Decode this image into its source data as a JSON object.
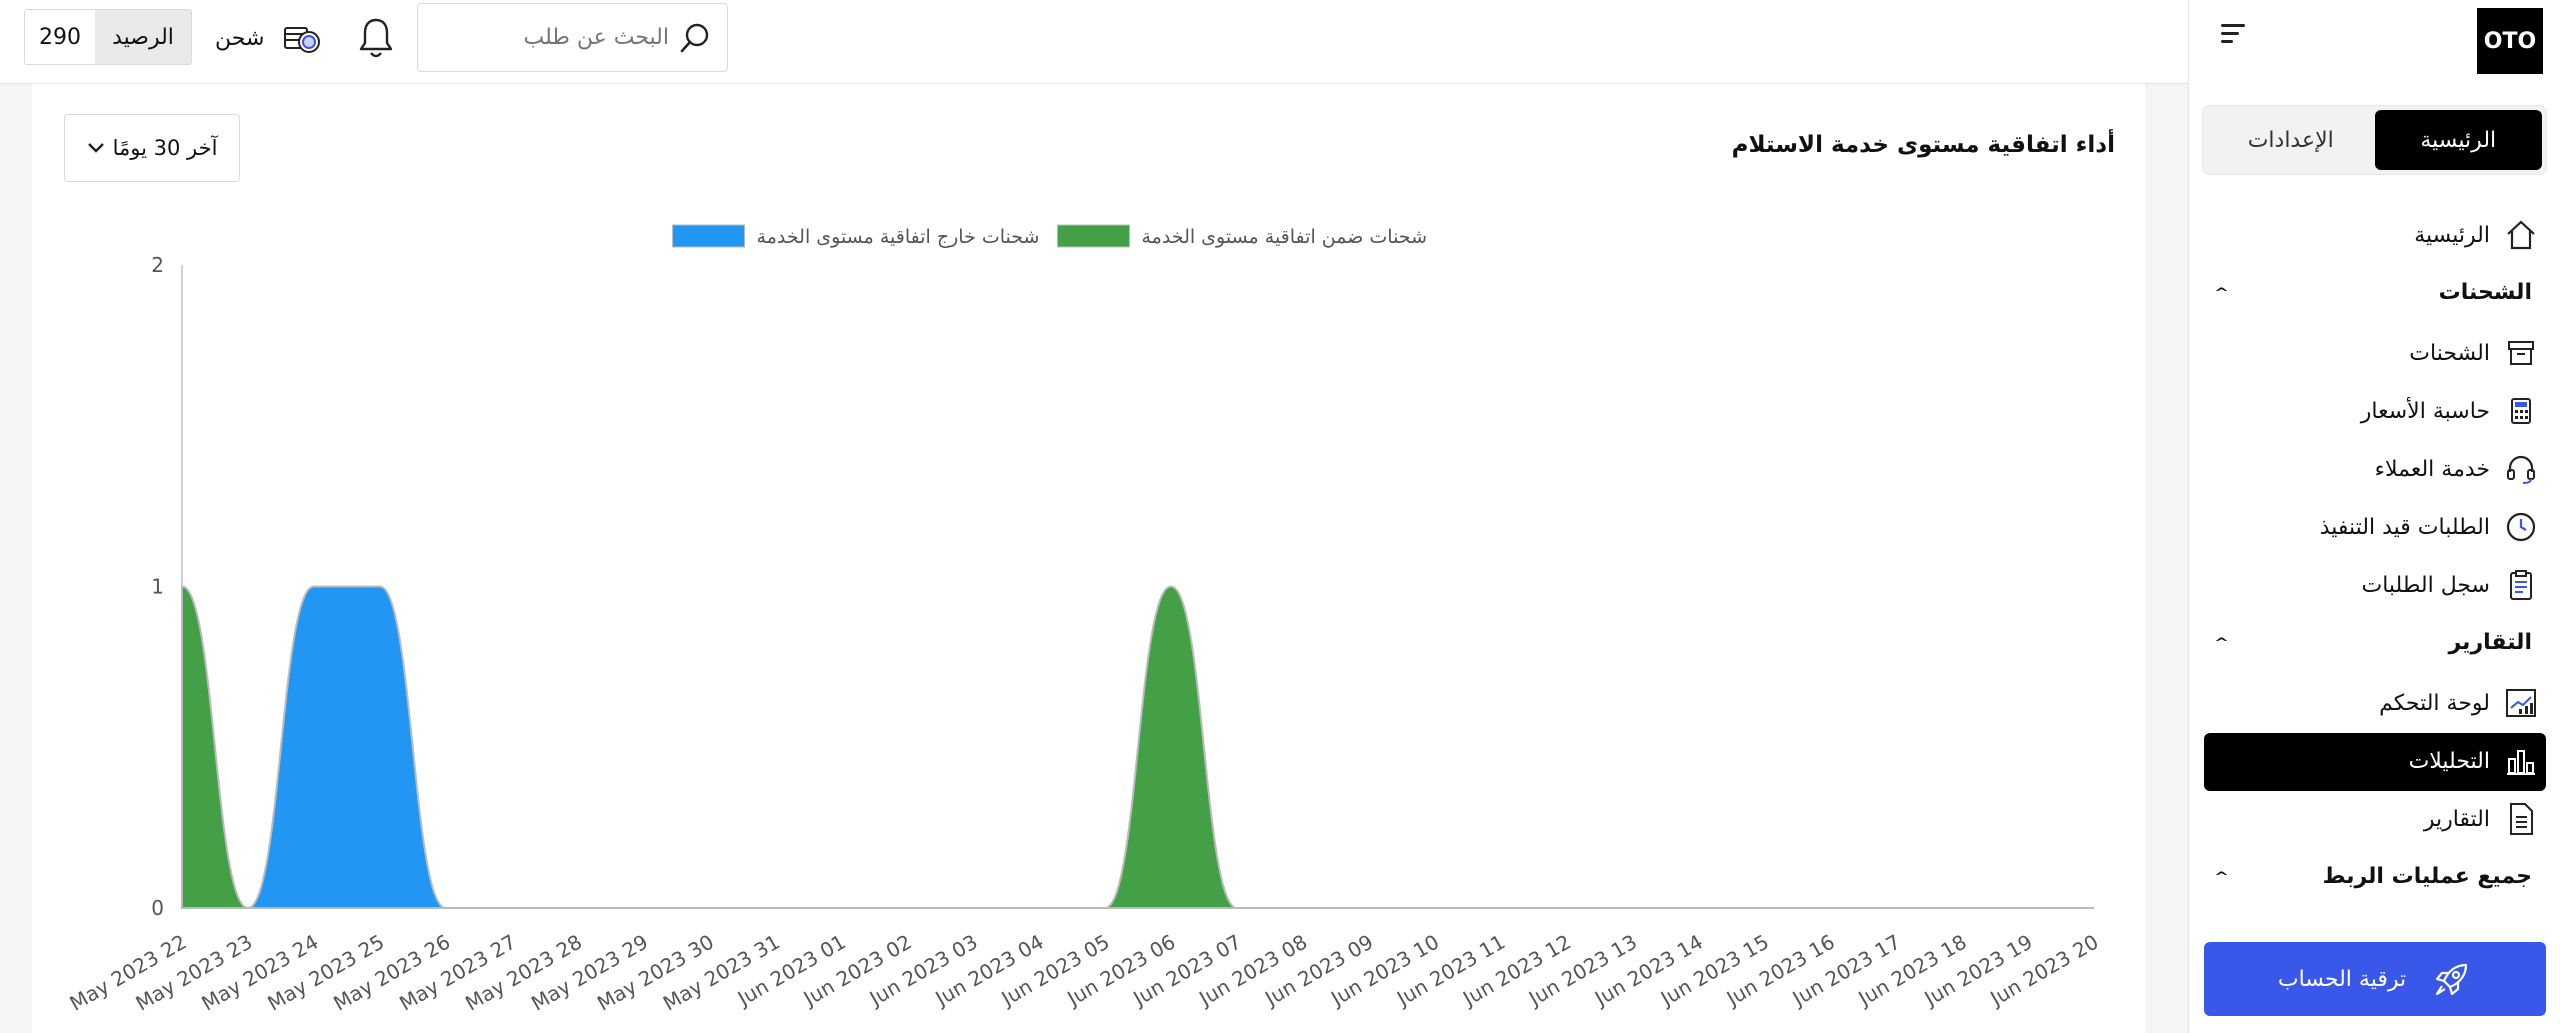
{
  "app": {
    "logo": "OTO"
  },
  "sidebar": {
    "tabs": [
      {
        "label": "الرئيسية",
        "active": true
      },
      {
        "label": "الإعدادات",
        "active": false
      }
    ],
    "home": "الرئيسية",
    "sections": {
      "shipments": "الشحنات",
      "reports": "التقارير",
      "integrations": "جميع عمليات الربط"
    },
    "items": {
      "shipments": "الشحنات",
      "price_calculator": "حاسبة الأسعار",
      "customer_service": "خدمة العملاء",
      "pending_orders": "الطلبات قيد التنفيذ",
      "orders_log": "سجل الطلبات",
      "dashboard": "لوحة التحكم",
      "analytics": "التحليلات",
      "reports": "التقارير"
    },
    "upgrade": "ترقية الحساب"
  },
  "header": {
    "search_placeholder": "البحث عن طلب",
    "ship_label": "شحن",
    "balance_label": "الرصيد",
    "balance_value": "290"
  },
  "card": {
    "title": "أداء اتفاقية مستوى خدمة الاستلام",
    "range_label": "آخر 30 يومًا"
  },
  "colors": {
    "within_sla": "#43a047",
    "outside_sla": "#2196f3",
    "active_nav": "#000000",
    "upgrade_button": "#3957e8"
  },
  "chart_data": {
    "type": "area",
    "title": "",
    "ylim": [
      0,
      2
    ],
    "y_ticks": [
      "0",
      "1",
      "2"
    ],
    "categories": [
      "May 2023 22",
      "May 2023 23",
      "May 2023 24",
      "May 2023 25",
      "May 2023 26",
      "May 2023 27",
      "May 2023 28",
      "May 2023 29",
      "May 2023 30",
      "May 2023 31",
      "Jun 2023 01",
      "Jun 2023 02",
      "Jun 2023 03",
      "Jun 2023 04",
      "Jun 2023 05",
      "Jun 2023 06",
      "Jun 2023 07",
      "Jun 2023 08",
      "Jun 2023 09",
      "Jun 2023 10",
      "Jun 2023 11",
      "Jun 2023 12",
      "Jun 2023 13",
      "Jun 2023 14",
      "Jun 2023 15",
      "Jun 2023 16",
      "Jun 2023 17",
      "Jun 2023 18",
      "Jun 2023 19",
      "Jun 2023 20"
    ],
    "series": [
      {
        "name": "شحنات ضمن اتفاقية مستوى الخدمة",
        "color": "#43a047",
        "values": [
          1,
          0,
          0,
          0,
          0,
          0,
          0,
          0,
          0,
          0,
          0,
          0,
          0,
          0,
          0,
          1,
          0,
          0,
          0,
          0,
          0,
          0,
          0,
          0,
          0,
          0,
          0,
          0,
          0,
          0
        ]
      },
      {
        "name": "شحنات خارج اتفاقية مستوى الخدمة",
        "color": "#2196f3",
        "values": [
          0,
          0,
          1,
          1,
          0,
          0,
          0,
          0,
          0,
          0,
          0,
          0,
          0,
          0,
          0,
          0,
          0,
          0,
          0,
          0,
          0,
          0,
          0,
          0,
          0,
          0,
          0,
          0,
          0,
          0
        ]
      }
    ],
    "legend": "top"
  }
}
